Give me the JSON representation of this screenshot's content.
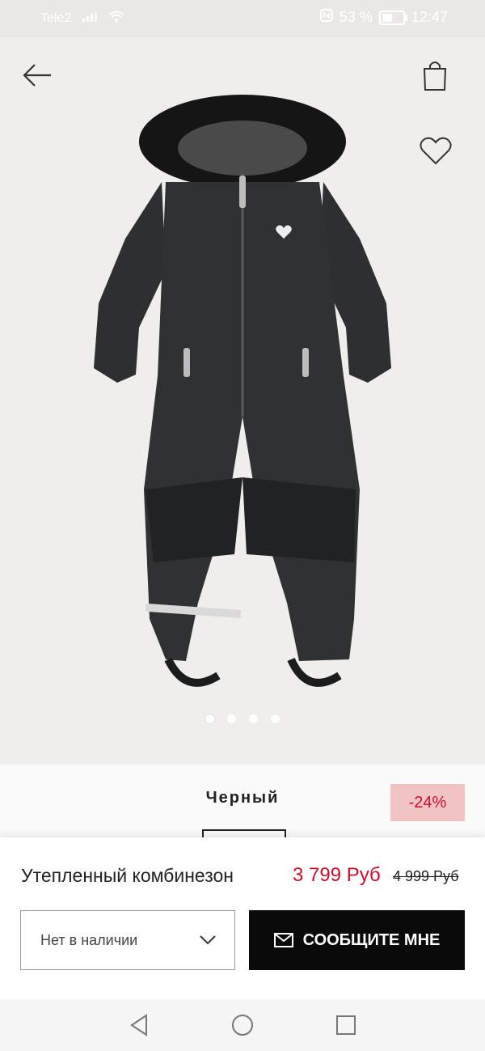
{
  "status_bar": {
    "carrier": "Tele2",
    "battery": "53 %",
    "time": "12:47"
  },
  "gallery": {
    "image_count": 4,
    "active_index": 0
  },
  "color": {
    "name": "Черный"
  },
  "discount": "-24%",
  "product": {
    "name": "Утепленный комбинезон",
    "price": "3 799 Руб",
    "old_price": "4 999 Руб"
  },
  "size_select": {
    "value": "Нет в наличии"
  },
  "notify_button": {
    "label": "СООБЩИТЕ МНЕ"
  },
  "colors": {
    "accent": "#c8102e",
    "discount_bg": "#f2c3c3",
    "button": "#0a0a0a"
  }
}
